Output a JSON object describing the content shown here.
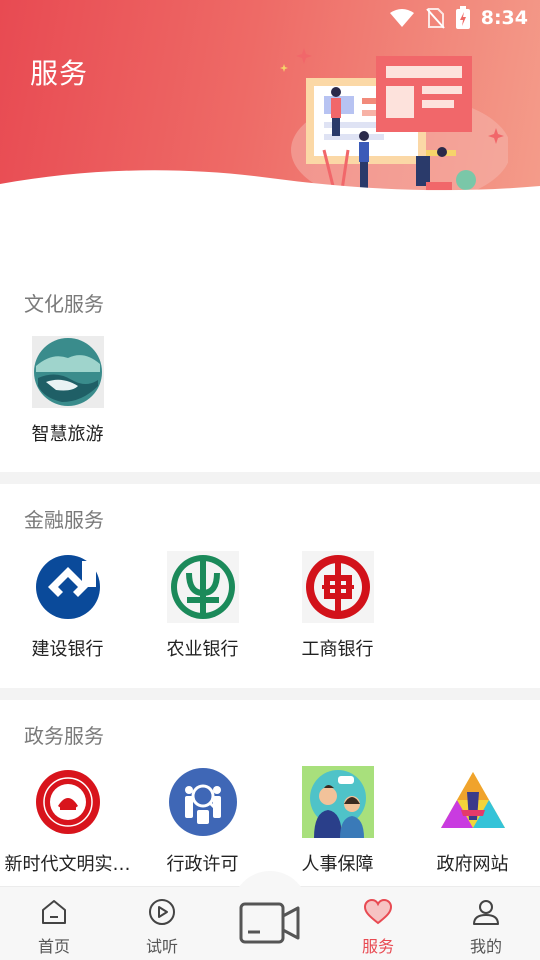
{
  "status_bar": {
    "time": "8:34"
  },
  "header": {
    "title": "服务"
  },
  "sections": [
    {
      "title": "文化服务",
      "items": [
        {
          "label": "智慧旅游",
          "icon": "tourism-landscape-icon"
        }
      ]
    },
    {
      "title": "金融服务",
      "items": [
        {
          "label": "建设银行",
          "icon": "ccb-logo-icon"
        },
        {
          "label": "农业银行",
          "icon": "abc-logo-icon"
        },
        {
          "label": "工商银行",
          "icon": "icbc-logo-icon"
        }
      ]
    },
    {
      "title": "政务服务",
      "items": [
        {
          "label": "新时代文明实…",
          "icon": "civilization-seal-icon"
        },
        {
          "label": "行政许可",
          "icon": "administrative-license-icon"
        },
        {
          "label": "人事保障",
          "icon": "personnel-icon"
        },
        {
          "label": "政府网站",
          "icon": "government-site-icon"
        }
      ]
    }
  ],
  "bottom_nav": [
    {
      "label": "首页",
      "icon": "home-icon",
      "active": false
    },
    {
      "label": "试听",
      "icon": "play-icon",
      "active": false
    },
    {
      "label": "",
      "icon": "video-camera-icon",
      "active": false
    },
    {
      "label": "服务",
      "icon": "heart-icon",
      "active": true
    },
    {
      "label": "我的",
      "icon": "user-icon",
      "active": false
    }
  ],
  "colors": {
    "accent": "#e84a52",
    "ccb_blue": "#0a4a9a",
    "abc_green": "#1b8a5a",
    "icbc_red": "#d2121a"
  }
}
